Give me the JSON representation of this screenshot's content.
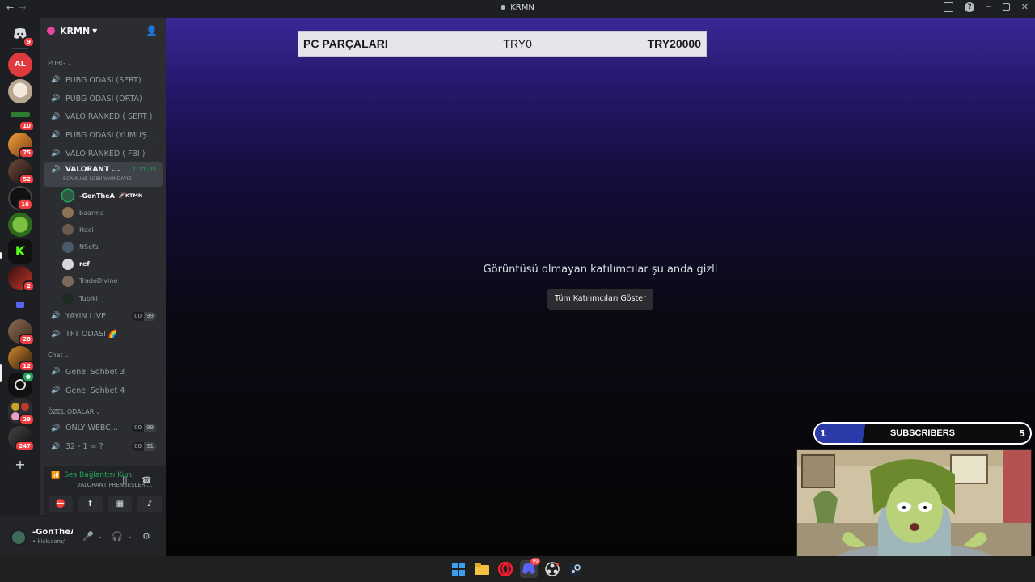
{
  "window": {
    "title": "KRMN",
    "back": "←",
    "forward": "→"
  },
  "server": {
    "name": "KRMN"
  },
  "guild_badges": [
    "9",
    "10",
    "75",
    "52",
    "16",
    "2",
    "28",
    "12",
    "29",
    "247"
  ],
  "categories": {
    "pubg": "PUBG",
    "chat": "Chat",
    "ozel": "ÖZEL ODALAR"
  },
  "channels": {
    "c1": "PUBG ODASI (SERT)",
    "c2": "PUBG ODASI (ORTA)",
    "c3": "VALO RANKED ( SERT )",
    "c4": "PUBG ODASI (YUMUŞ...",
    "c5": "VALO RANKED ( FBI )",
    "active": "VALORANT ...",
    "active_timer": "2:31:25",
    "active_sub": "SCAMLINE LOBII YAYINDAYIZ",
    "yayin": "YAYIN LİVE",
    "yayin_a": "00",
    "yayin_b": "99",
    "tft": "TFT ODASI 🌈",
    "g3": "Genel Sohbet 3",
    "g4": "Genel Sohbet 4",
    "only": "ONLY WEBC...",
    "only_a": "00",
    "only_b": "99",
    "n32": "32 - 1 = ?",
    "n32_a": "00",
    "n32_b": "31"
  },
  "users": {
    "u1": "-GonTheA",
    "u1_tag": "KTMN",
    "u2": "baarma",
    "u3": "Haci",
    "u4": "NSefa",
    "u5": "ref",
    "u6": "TradeDivine",
    "u7": "Tubiki"
  },
  "voice": {
    "status": "Ses Bağlantısı Kuruldu",
    "channel": "VALORANT PRENSESLERİ..."
  },
  "me": {
    "name": "-GonTheA",
    "sub": "• kick.com/"
  },
  "stage": {
    "bar_title": "PC PARÇALARI",
    "bar_current": "TRY0",
    "bar_goal": "TRY20000",
    "message": "Görüntüsü olmayan katılımcılar şu anda gizli",
    "show_button": "Tüm Katılımcıları Göster"
  },
  "subscribers": {
    "label": "SUBSCRIBERS",
    "current": "1",
    "goal": "5",
    "progress": 0.2
  },
  "taskbar_badge": "99"
}
